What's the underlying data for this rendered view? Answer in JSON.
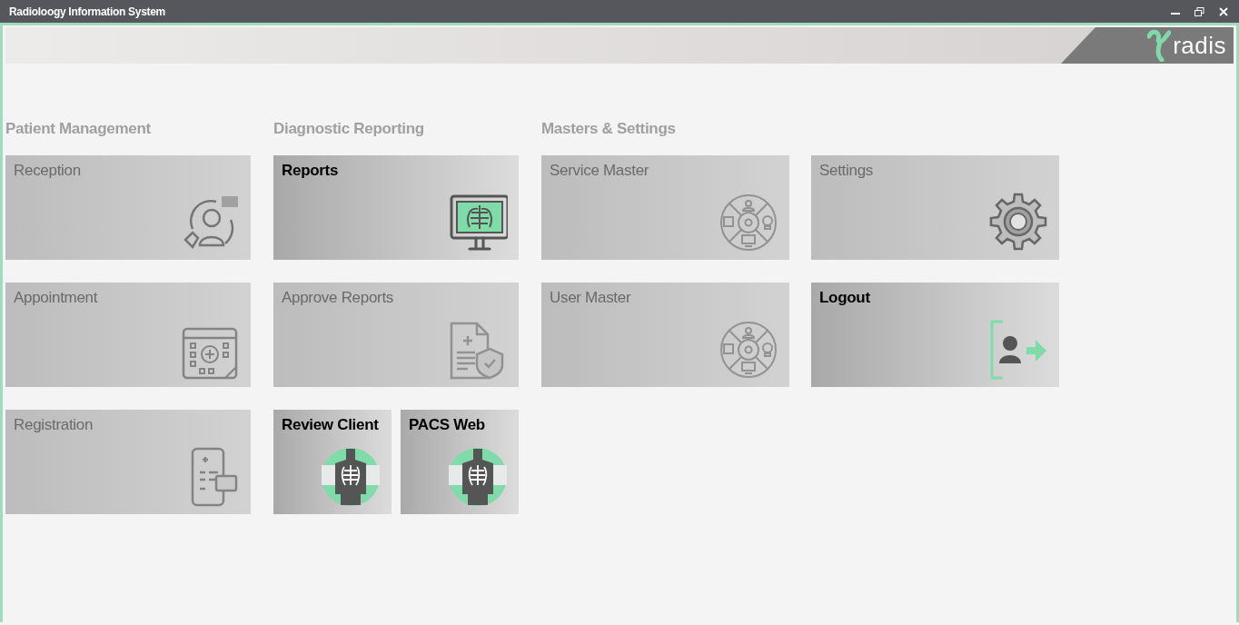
{
  "window": {
    "title": "Radioloogy Information System"
  },
  "banner": {
    "logo_text": "radis"
  },
  "sections": [
    {
      "title": "Patient Management",
      "rows": [
        [
          {
            "label": "Reception",
            "kind": "headset",
            "enabled": false
          }
        ],
        [
          {
            "label": "Appointment",
            "kind": "calendar",
            "enabled": false
          }
        ],
        [
          {
            "label": "Registration",
            "kind": "phone",
            "enabled": false
          }
        ]
      ]
    },
    {
      "title": "Diagnostic Reporting",
      "rows": [
        [
          {
            "label": "Reports",
            "kind": "monitor",
            "enabled": true
          }
        ],
        [
          {
            "label": "Approve Reports",
            "kind": "document",
            "enabled": false
          }
        ],
        [
          {
            "label": "Review Client",
            "kind": "body",
            "enabled": true
          },
          {
            "label": "PACS Web",
            "kind": "body",
            "enabled": true
          }
        ]
      ]
    },
    {
      "title": "Masters & Settings",
      "rows": [
        [
          {
            "label": "Service Master",
            "kind": "hub",
            "enabled": false
          },
          {
            "label": "Settings",
            "kind": "gear",
            "enabled": false
          }
        ],
        [
          {
            "label": "User Master",
            "kind": "hub",
            "enabled": false
          },
          {
            "label": "Logout",
            "kind": "logout",
            "enabled": true
          }
        ]
      ]
    }
  ]
}
